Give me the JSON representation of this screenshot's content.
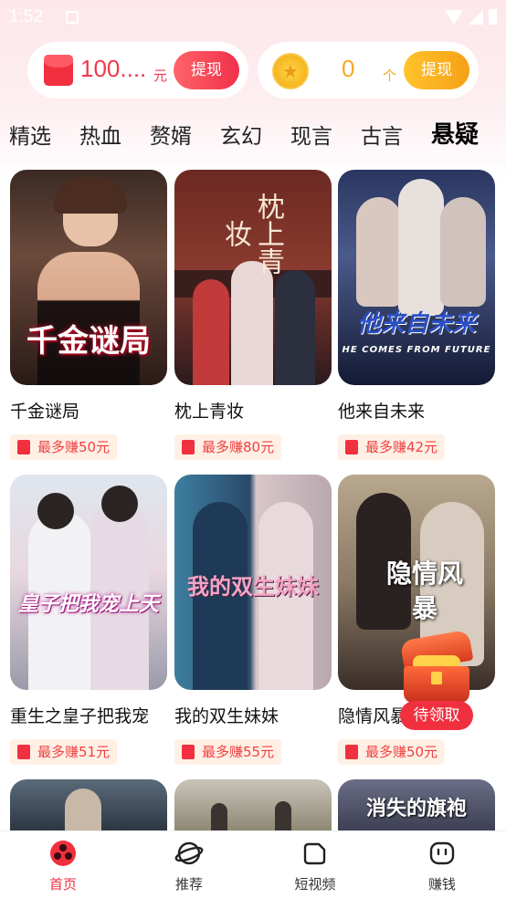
{
  "status_bar": {
    "time": "1:52"
  },
  "wallet": {
    "cash_amount": "100....",
    "cash_unit": "元",
    "cash_button": "提现",
    "coin_amount": "0",
    "coin_unit": "个",
    "coin_button": "提现"
  },
  "tabs": [
    "精选",
    "热血",
    "赘婿",
    "玄幻",
    "现言",
    "古言",
    "悬疑"
  ],
  "active_tab": "悬疑",
  "dramas": [
    {
      "title": "千金谜局",
      "reward": "最多赚50元",
      "poster_text": "千金谜局"
    },
    {
      "title": "枕上青妆",
      "reward": "最多赚80元",
      "poster_text": "枕上青妆"
    },
    {
      "title": "他来自未来",
      "reward": "最多赚42元",
      "poster_text": "他来自未来",
      "poster_sub": "HE COMES FROM FUTURE"
    },
    {
      "title": "重生之皇子把我宠",
      "reward": "最多赚51元",
      "poster_text": "皇子把我宠上天"
    },
    {
      "title": "我的双生妹妹",
      "reward": "最多赚55元",
      "poster_text": "我的双生妹妹"
    },
    {
      "title": "隐情风暴",
      "reward": "最多赚50元",
      "poster_text": "隐情风暴"
    },
    {
      "poster_text": ""
    },
    {
      "poster_text": ""
    },
    {
      "poster_text": "消失的旗袍"
    }
  ],
  "pending_badge": "待领取",
  "bottom_nav": [
    {
      "label": "首页",
      "icon": "home-icon"
    },
    {
      "label": "推荐",
      "icon": "planet-icon"
    },
    {
      "label": "短视频",
      "icon": "short-video-icon"
    },
    {
      "label": "赚钱",
      "icon": "earn-icon"
    }
  ],
  "colors": {
    "accent": "#f0303f",
    "gold": "#f6a823",
    "reward_bg": "#fff0e6"
  }
}
